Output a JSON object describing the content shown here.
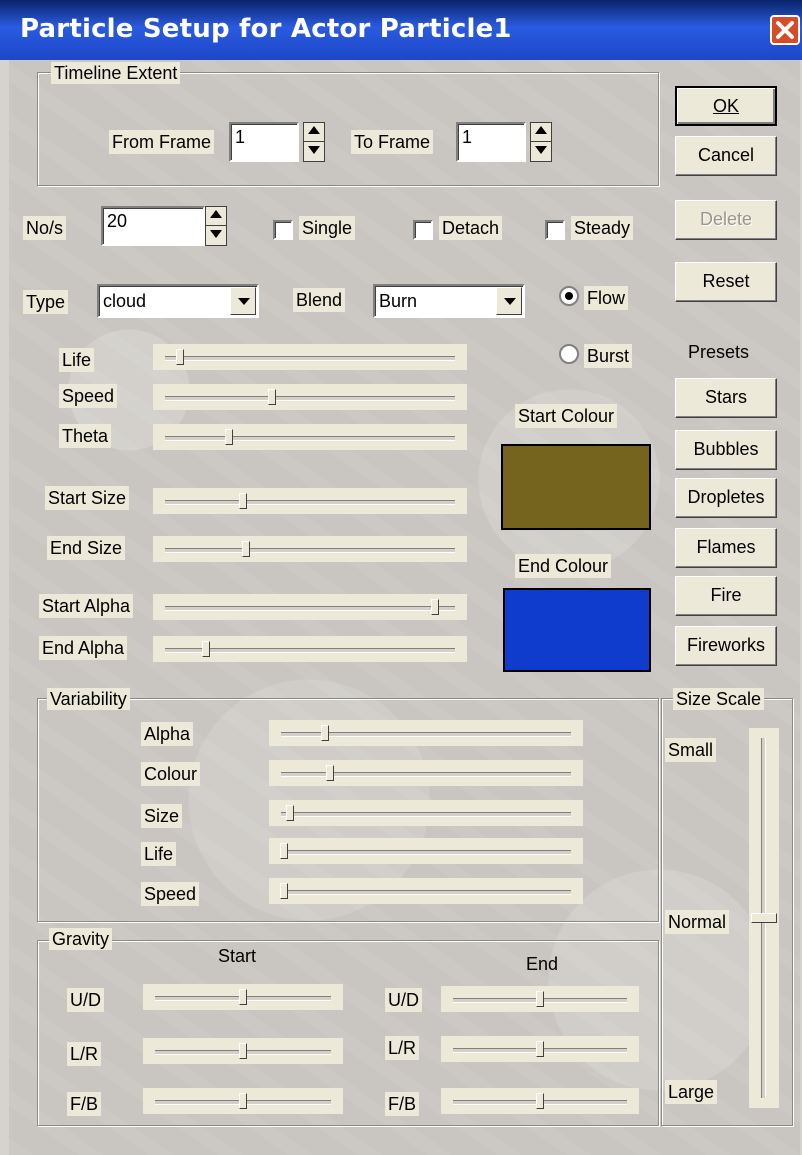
{
  "window": {
    "title": "Particle Setup for Actor Particle1",
    "close_icon": "close-icon"
  },
  "timeline": {
    "group_label": "Timeline Extent",
    "from_label": "From Frame",
    "from_value": "1",
    "to_label": "To Frame",
    "to_value": "1"
  },
  "buttons": {
    "ok": "OK",
    "cancel": "Cancel",
    "delete": "Delete",
    "reset": "Reset",
    "presets_label": "Presets",
    "presets": [
      "Stars",
      "Bubbles",
      "Dropletes",
      "Flames",
      "Fire",
      "Fireworks"
    ]
  },
  "emission": {
    "nos_label": "No/s",
    "nos_value": "20",
    "single_label": "Single",
    "single_checked": false,
    "detach_label": "Detach",
    "detach_checked": false,
    "steady_label": "Steady",
    "steady_checked": false
  },
  "type": {
    "label": "Type",
    "value": "cloud"
  },
  "blend": {
    "label": "Blend",
    "value": "Burn"
  },
  "mode": {
    "flow_label": "Flow",
    "burst_label": "Burst",
    "selected": "Flow"
  },
  "sliders": [
    {
      "label": "Life",
      "value": 0.05
    },
    {
      "label": "Speed",
      "value": 0.37
    },
    {
      "label": "Theta",
      "value": 0.22
    },
    {
      "label": "Start Size",
      "value": 0.27
    },
    {
      "label": "End Size",
      "value": 0.28
    },
    {
      "label": "Start Alpha",
      "value": 0.93
    },
    {
      "label": "End Alpha",
      "value": 0.14
    }
  ],
  "colours": {
    "start_label": "Start Colour",
    "start_color": "#74641e",
    "end_label": "End Colour",
    "end_color": "#0f3ccc"
  },
  "variability": {
    "group_label": "Variability",
    "sliders": [
      {
        "label": "Alpha",
        "value": 0.15
      },
      {
        "label": "Colour",
        "value": 0.17
      },
      {
        "label": "Size",
        "value": 0.03
      },
      {
        "label": "Life",
        "value": 0.01
      },
      {
        "label": "Speed",
        "value": 0.01
      }
    ]
  },
  "gravity": {
    "group_label": "Gravity",
    "start_label": "Start",
    "end_label": "End",
    "start": [
      {
        "label": "U/D",
        "value": 0.5
      },
      {
        "label": "L/R",
        "value": 0.5
      },
      {
        "label": "F/B",
        "value": 0.5
      }
    ],
    "end": [
      {
        "label": "U/D",
        "value": 0.5
      },
      {
        "label": "L/R",
        "value": 0.5
      },
      {
        "label": "F/B",
        "value": 0.5
      }
    ]
  },
  "size_scale": {
    "group_label": "Size Scale",
    "small_label": "Small",
    "normal_label": "Normal",
    "large_label": "Large",
    "value": 0.5
  }
}
